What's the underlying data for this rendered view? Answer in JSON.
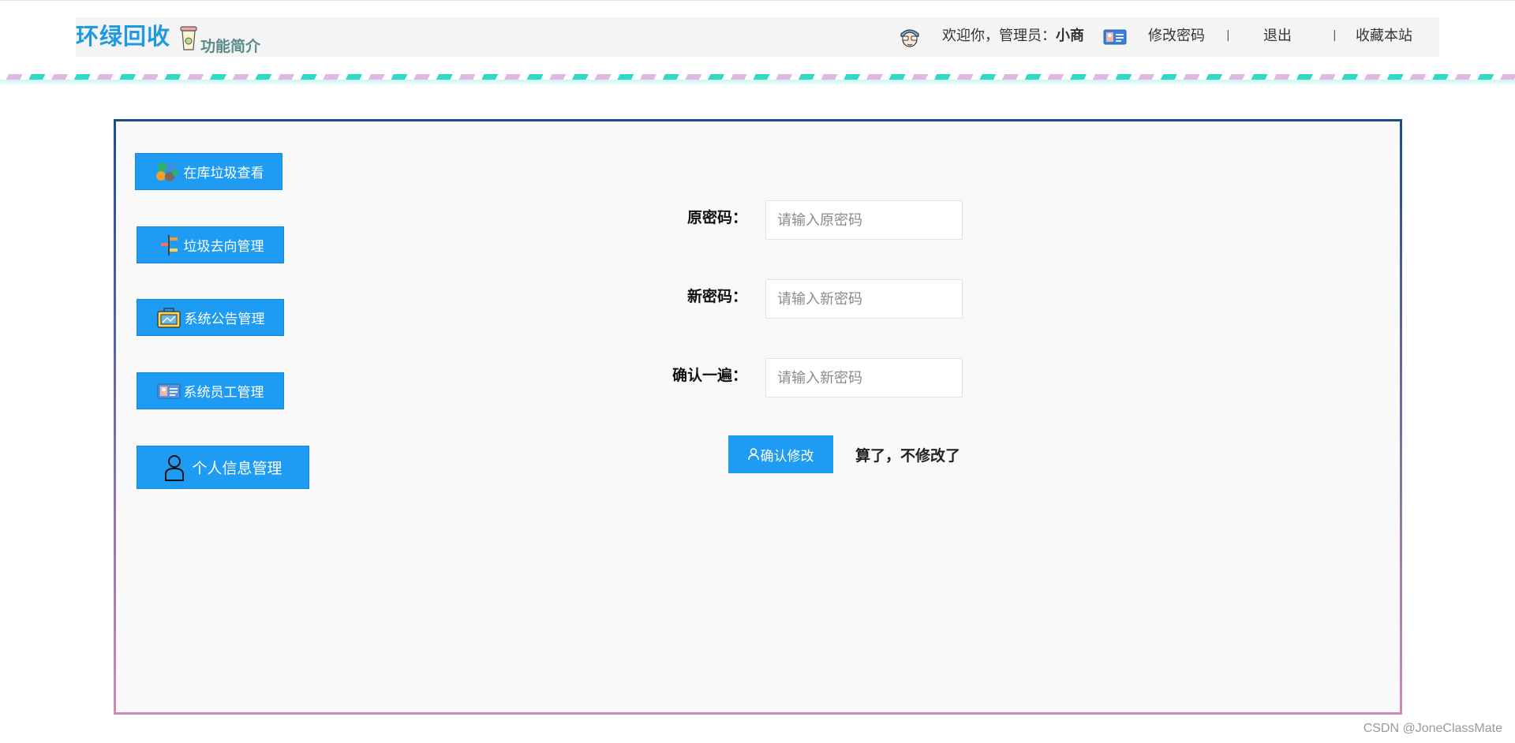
{
  "header": {
    "brand": "环绿回收",
    "intro_label": "功能简介",
    "welcome_prefix": "欢迎你，管理员：",
    "username": "小商",
    "change_password": "修改密码",
    "separator": "|",
    "logout": "退出",
    "bookmark": "收藏本站"
  },
  "sidebar": {
    "items": [
      {
        "label": "在库垃圾查看",
        "icon": "recycle-icon"
      },
      {
        "label": "垃圾去向管理",
        "icon": "direction-icon"
      },
      {
        "label": "系统公告管理",
        "icon": "announcement-icon"
      },
      {
        "label": "系统员工管理",
        "icon": "staff-card-icon"
      },
      {
        "label": "个人信息管理",
        "icon": "user-icon"
      }
    ]
  },
  "form": {
    "old_password": {
      "label": "原密码：",
      "placeholder": "请输入原密码",
      "value": ""
    },
    "new_password": {
      "label": "新密码：",
      "placeholder": "请输入新密码",
      "value": ""
    },
    "confirm_password": {
      "label": "确认一遍：",
      "placeholder": "请输入新密码",
      "value": ""
    },
    "submit_label": "确认修改",
    "cancel_label": "算了，不修改了"
  },
  "watermark": "CSDN @JoneClassMate",
  "colors": {
    "brand": "#1e9be0",
    "button": "#1e9bf2",
    "panel_border_top": "#1e4c88",
    "panel_border_bottom": "#c98db5",
    "stripe_pink": "#e2b7e2",
    "stripe_teal": "#2fd9c4"
  }
}
